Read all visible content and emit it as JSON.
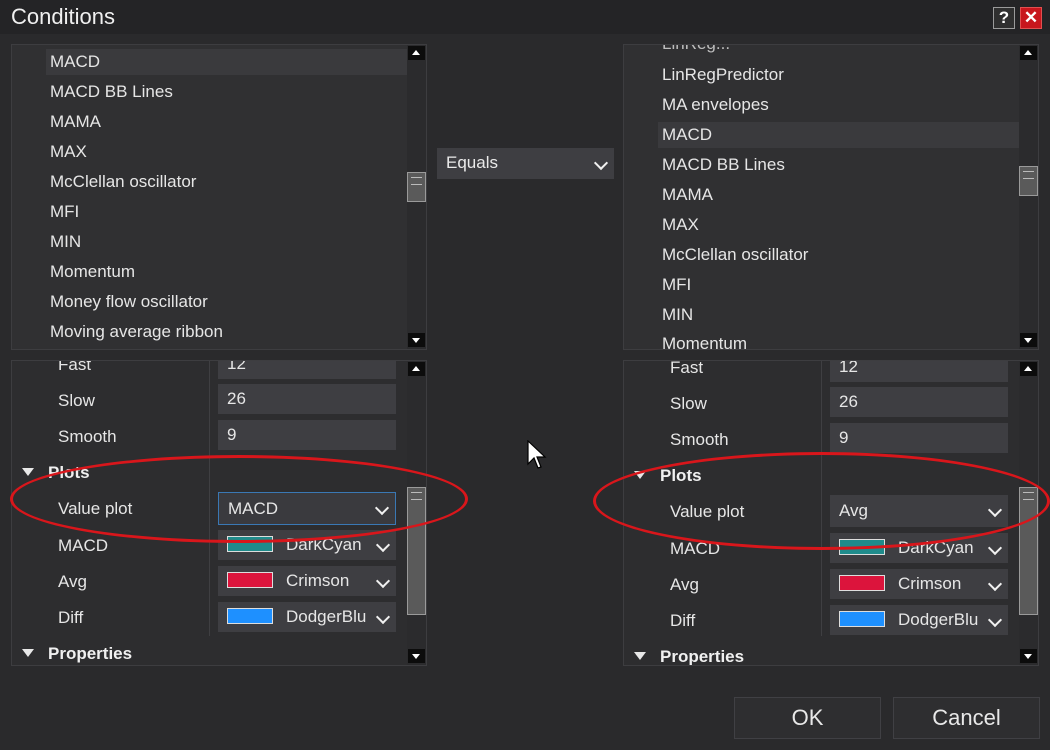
{
  "dialog": {
    "title": "Conditions",
    "help_label": "?",
    "close_label": "✕"
  },
  "left_list": {
    "items": [
      "MACD",
      "MACD BB Lines",
      "MAMA",
      "MAX",
      "McClellan oscillator",
      "MFI",
      "MIN",
      "Momentum",
      "Money flow oscillator",
      "Moving average ribbon"
    ],
    "selected": "MACD"
  },
  "operator": {
    "value": "Equals"
  },
  "right_list": {
    "partial_top": "LinReg...",
    "items": [
      "LinRegPredictor",
      "MA envelopes",
      "MACD",
      "MACD BB Lines",
      "MAMA",
      "MAX",
      "McClellan oscillator",
      "MFI",
      "MIN",
      "Momentum"
    ],
    "selected": "MACD"
  },
  "left_props": {
    "fast_label": "Fast",
    "fast_value": "12",
    "slow_label": "Slow",
    "slow_value": "26",
    "smooth_label": "Smooth",
    "smooth_value": "9",
    "plots_label": "Plots",
    "value_plot_label": "Value plot",
    "value_plot_value": "MACD",
    "macd_label": "MACD",
    "macd_color": "DarkCyan",
    "avg_label": "Avg",
    "avg_color": "Crimson",
    "diff_label": "Diff",
    "diff_color": "DodgerBlu",
    "properties_label": "Properties"
  },
  "right_props": {
    "fast_label": "Fast",
    "fast_value": "12",
    "slow_label": "Slow",
    "slow_value": "26",
    "smooth_label": "Smooth",
    "smooth_value": "9",
    "plots_label": "Plots",
    "value_plot_label": "Value plot",
    "value_plot_value": "Avg",
    "macd_label": "MACD",
    "macd_color": "DarkCyan",
    "avg_label": "Avg",
    "avg_color": "Crimson",
    "diff_label": "Diff",
    "diff_color": "DodgerBlu",
    "properties_label": "Properties"
  },
  "colors": {
    "darkcyan": "#1f8b8b",
    "crimson": "#dc143c",
    "dodgerblue": "#1e90ff",
    "annotation": "#d9161b"
  },
  "footer": {
    "ok_label": "OK",
    "cancel_label": "Cancel"
  }
}
